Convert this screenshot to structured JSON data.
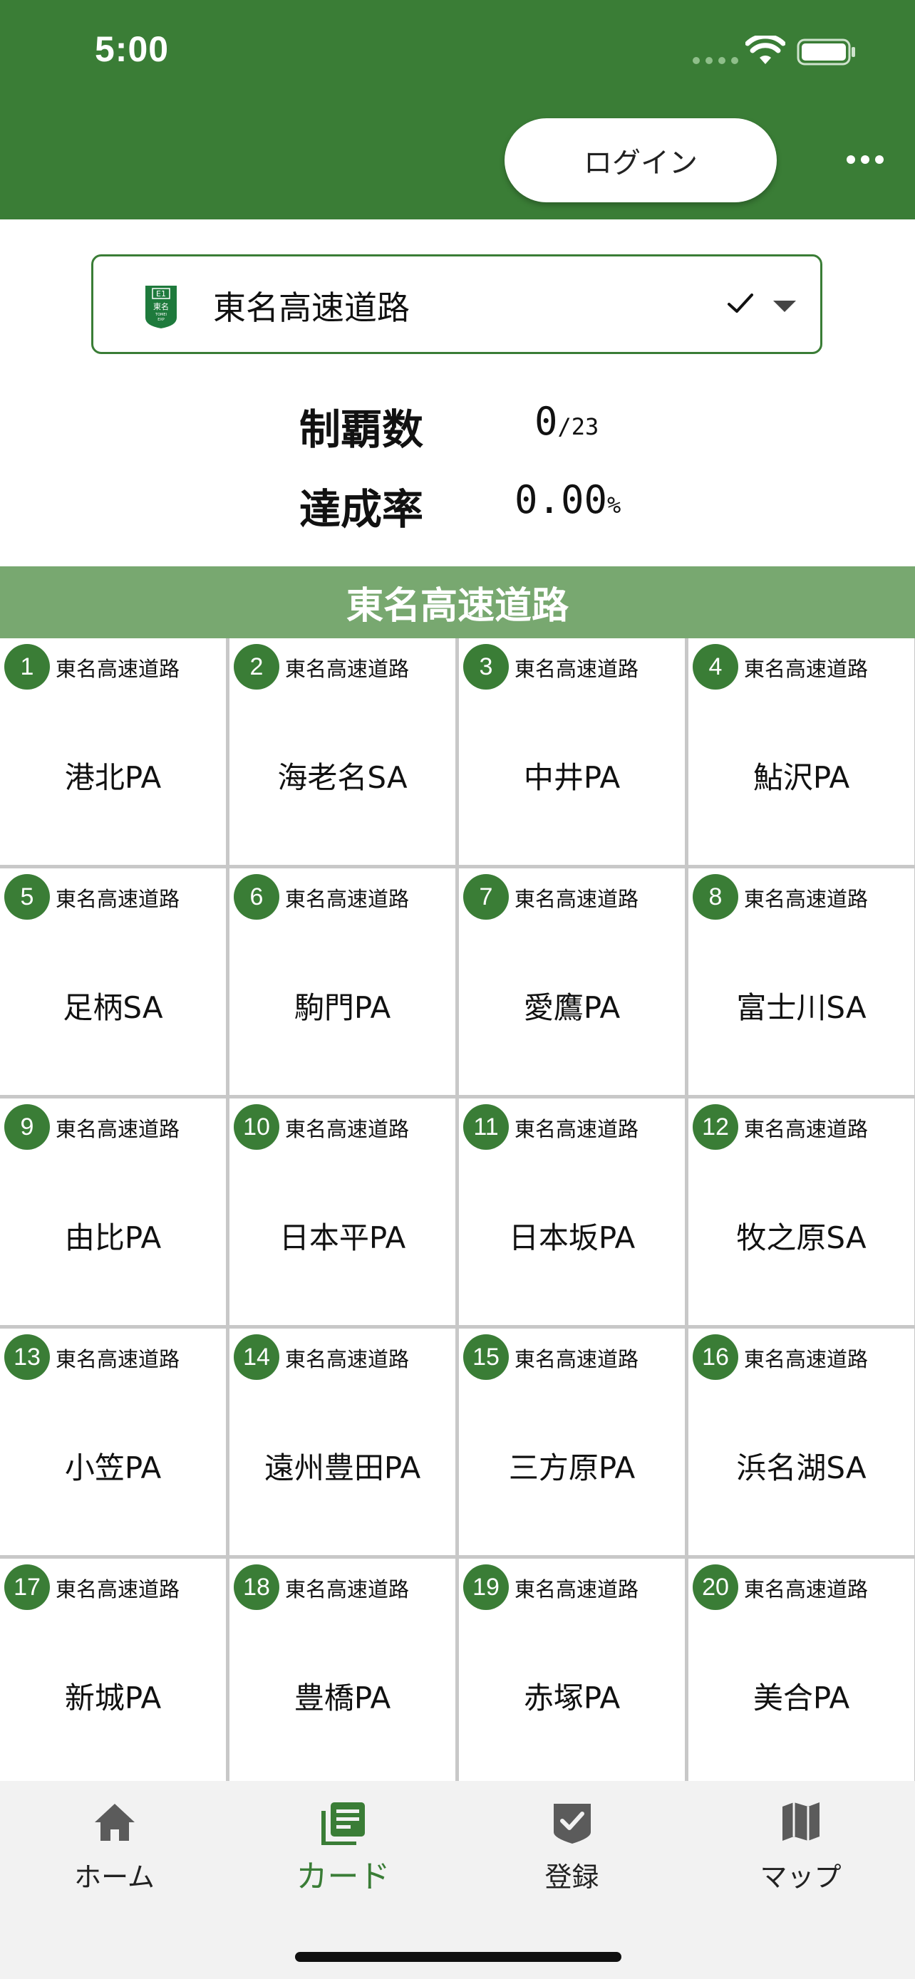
{
  "status_bar": {
    "time": "5:00"
  },
  "header": {
    "login_label": "ログイン"
  },
  "route_select": {
    "badge_code": "E1",
    "badge_name": "東名",
    "badge_sub": "TOMEI",
    "badge_sub2": "EXP",
    "selected": "東名高速道路"
  },
  "stats": {
    "conquered_label": "制覇数",
    "conquered_count": "0",
    "conquered_total": "/23",
    "rate_label": "達成率",
    "rate_value": "0.00",
    "rate_unit": "%"
  },
  "section": {
    "title": "東名高速道路"
  },
  "cards": [
    {
      "num": "1",
      "route": "東名高速道路",
      "name": "港北PA"
    },
    {
      "num": "2",
      "route": "東名高速道路",
      "name": "海老名SA"
    },
    {
      "num": "3",
      "route": "東名高速道路",
      "name": "中井PA"
    },
    {
      "num": "4",
      "route": "東名高速道路",
      "name": "鮎沢PA"
    },
    {
      "num": "5",
      "route": "東名高速道路",
      "name": "足柄SA"
    },
    {
      "num": "6",
      "route": "東名高速道路",
      "name": "駒門PA"
    },
    {
      "num": "7",
      "route": "東名高速道路",
      "name": "愛鷹PA"
    },
    {
      "num": "8",
      "route": "東名高速道路",
      "name": "富士川SA"
    },
    {
      "num": "9",
      "route": "東名高速道路",
      "name": "由比PA"
    },
    {
      "num": "10",
      "route": "東名高速道路",
      "name": "日本平PA"
    },
    {
      "num": "11",
      "route": "東名高速道路",
      "name": "日本坂PA"
    },
    {
      "num": "12",
      "route": "東名高速道路",
      "name": "牧之原SA"
    },
    {
      "num": "13",
      "route": "東名高速道路",
      "name": "小笠PA"
    },
    {
      "num": "14",
      "route": "東名高速道路",
      "name": "遠州豊田PA"
    },
    {
      "num": "15",
      "route": "東名高速道路",
      "name": "三方原PA"
    },
    {
      "num": "16",
      "route": "東名高速道路",
      "name": "浜名湖SA"
    },
    {
      "num": "17",
      "route": "東名高速道路",
      "name": "新城PA"
    },
    {
      "num": "18",
      "route": "東名高速道路",
      "name": "豊橋PA"
    },
    {
      "num": "19",
      "route": "東名高速道路",
      "name": "赤塚PA"
    },
    {
      "num": "20",
      "route": "東名高速道路",
      "name": "美合PA"
    }
  ],
  "tabs": [
    {
      "label": "ホーム",
      "icon": "home-icon",
      "active": false
    },
    {
      "label": "カード",
      "icon": "cards-icon",
      "active": true
    },
    {
      "label": "登録",
      "icon": "register-check-icon",
      "active": false
    },
    {
      "label": "マップ",
      "icon": "map-icon",
      "active": false
    }
  ],
  "colors": {
    "primary": "#3a7d36",
    "banner": "#78a870",
    "tabbar": "#f2f2f2"
  }
}
